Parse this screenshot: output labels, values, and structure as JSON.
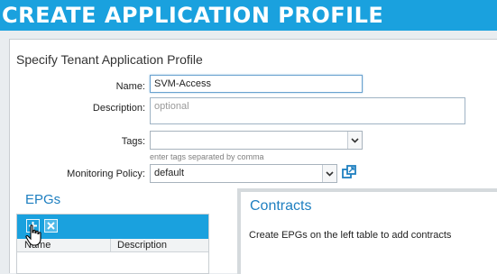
{
  "header": {
    "title": "CREATE APPLICATION PROFILE"
  },
  "form": {
    "section_title": "Specify Tenant Application Profile",
    "name": {
      "label": "Name:",
      "value": "SVM-Access"
    },
    "description": {
      "label": "Description:",
      "placeholder": "optional"
    },
    "tags": {
      "label": "Tags:",
      "value": "",
      "hint": "enter tags separated by comma"
    },
    "monitoring_policy": {
      "label": "Monitoring Policy:",
      "value": "default"
    }
  },
  "epgs": {
    "title": "EPGs",
    "columns": [
      "Name",
      "Description"
    ],
    "toolbar": {
      "add_icon": "add-icon",
      "delete_icon": "delete-icon"
    }
  },
  "contracts": {
    "title": "Contracts",
    "message": "Create EPGs on the left table to add contracts"
  },
  "colors": {
    "accent": "#1aa1de",
    "heading_blue": "#1e7fc0"
  }
}
